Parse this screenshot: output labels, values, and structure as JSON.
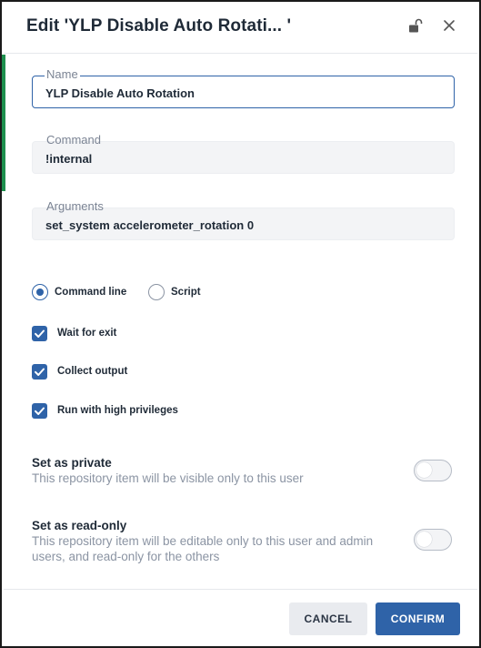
{
  "dialog": {
    "title": "Edit 'YLP Disable Auto Rotati... '",
    "icons": {
      "lock": "unlock-icon",
      "close": "close-icon"
    }
  },
  "fields": {
    "name": {
      "label": "Name",
      "value": "YLP Disable Auto Rotation"
    },
    "command": {
      "label": "Command",
      "value": "!internal"
    },
    "arguments": {
      "label": "Arguments",
      "value": "set_system accelerometer_rotation 0"
    }
  },
  "mode": {
    "options": [
      {
        "label": "Command line",
        "selected": true
      },
      {
        "label": "Script",
        "selected": false
      }
    ]
  },
  "checkboxes": [
    {
      "label": "Wait for exit",
      "checked": true
    },
    {
      "label": "Collect output",
      "checked": true
    },
    {
      "label": "Run with high privileges",
      "checked": true
    }
  ],
  "settings": {
    "private": {
      "title": "Set as private",
      "description": "This repository item will be visible only to this user",
      "enabled": false
    },
    "readonly": {
      "title": "Set as read-only",
      "description": "This repository item will be editable only to this user and admin users, and read-only for the others",
      "enabled": false
    }
  },
  "buttons": {
    "cancel": "CANCEL",
    "confirm": "CONFIRM"
  },
  "colors": {
    "accent": "#2f63a8",
    "left_bar": "#1e8f4e"
  }
}
